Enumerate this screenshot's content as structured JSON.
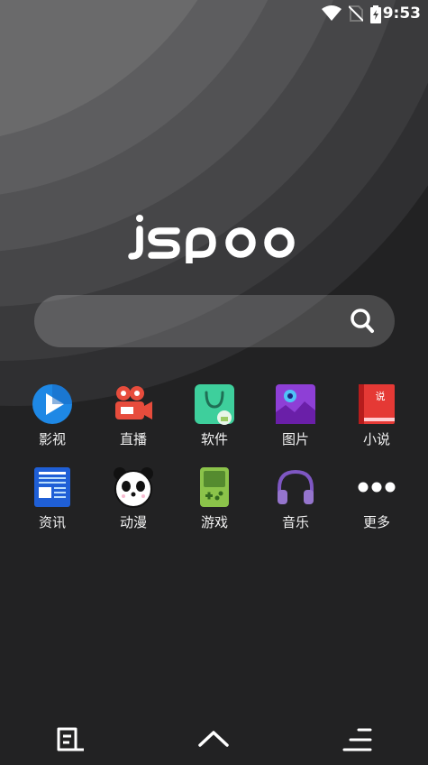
{
  "status_bar": {
    "time": "9:53",
    "icons": [
      "wifi-icon",
      "no-sim-icon",
      "battery-charging-icon"
    ]
  },
  "brand": {
    "logo_text": "jspoo"
  },
  "search": {
    "icon": "search-icon",
    "placeholder": ""
  },
  "apps": [
    {
      "label": "影视",
      "icon": "video-play-icon",
      "color": "#1e88e5"
    },
    {
      "label": "直播",
      "icon": "live-camera-icon",
      "color": "#e74c3c"
    },
    {
      "label": "软件",
      "icon": "app-store-bag-icon",
      "color": "#3ecf9c"
    },
    {
      "label": "图片",
      "icon": "picture-monster-icon",
      "color": "#8e3fd6"
    },
    {
      "label": "小说",
      "icon": "novel-book-icon",
      "color": "#e53935"
    },
    {
      "label": "资讯",
      "icon": "news-document-icon",
      "color": "#1f5fd6"
    },
    {
      "label": "动漫",
      "icon": "panda-icon",
      "color": "#ffffff"
    },
    {
      "label": "游戏",
      "icon": "gameboy-icon",
      "color": "#8bc34a"
    },
    {
      "label": "音乐",
      "icon": "headphones-icon",
      "color": "#7e57c2"
    },
    {
      "label": "更多",
      "icon": "more-dots-icon",
      "color": "#ffffff"
    }
  ],
  "bottom_nav": [
    "notes-icon",
    "chevron-up-icon",
    "menu-lines-icon"
  ]
}
